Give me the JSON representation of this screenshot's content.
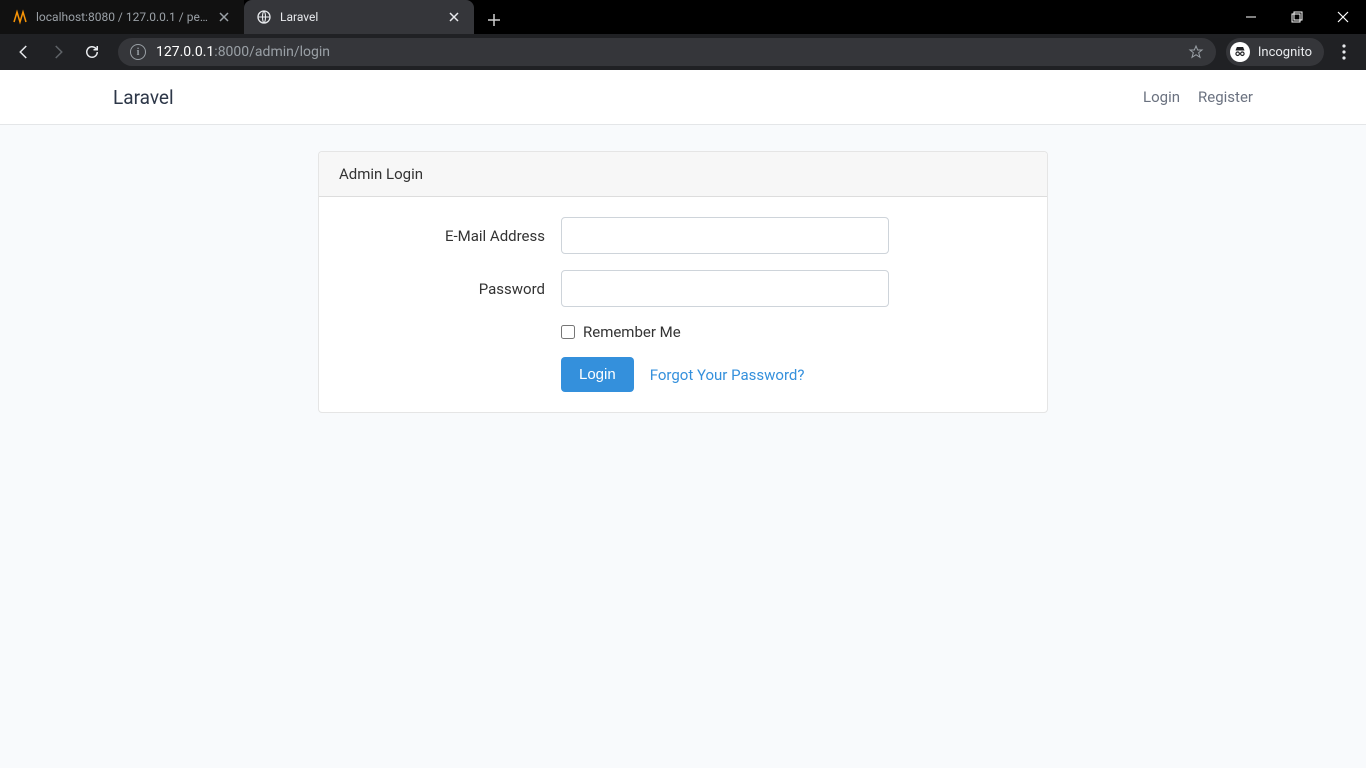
{
  "browser": {
    "tabs": [
      {
        "title": "localhost:8080 / 127.0.0.1 / pend…"
      },
      {
        "title": "Laravel"
      }
    ],
    "url_host": "127.0.0.1",
    "url_path": ":8000/admin/login",
    "incognito_label": "Incognito"
  },
  "navbar": {
    "brand": "Laravel",
    "links": {
      "login": "Login",
      "register": "Register"
    }
  },
  "card": {
    "header": "Admin Login",
    "email_label": "E-Mail Address",
    "password_label": "Password",
    "remember_label": "Remember Me",
    "submit_label": "Login",
    "forgot_label": "Forgot Your Password?"
  }
}
